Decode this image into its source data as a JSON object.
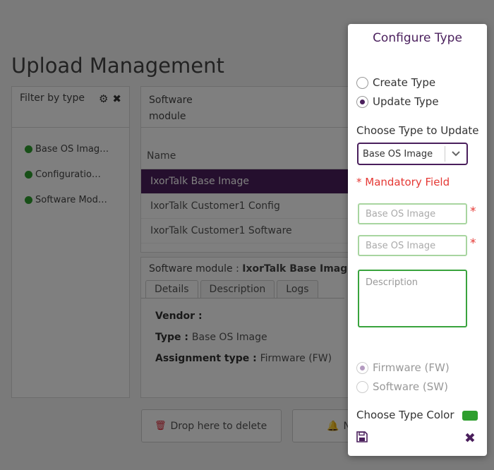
{
  "page": {
    "title": "Upload Management"
  },
  "filter": {
    "title": "Filter by type",
    "items": [
      {
        "label": "Base OS Imag…"
      },
      {
        "label": "Configuratio…"
      },
      {
        "label": "Software Mod…"
      }
    ]
  },
  "software_module": {
    "title_line1": "Software",
    "title_line2": "module",
    "column_name": "Name",
    "rows": [
      {
        "label": "IxorTalk Base Image"
      },
      {
        "label": "IxorTalk Customer1 Config"
      },
      {
        "label": "IxorTalk Customer1 Software"
      }
    ]
  },
  "details": {
    "title_prefix": "Software module : ",
    "title_value": "IxorTalk Base Image",
    "tabs": [
      {
        "label": "Details"
      },
      {
        "label": "Description"
      },
      {
        "label": "Logs"
      }
    ],
    "vendor_label": "Vendor :",
    "type_label": "Type : ",
    "type_value": "Base OS Image",
    "assignment_label": "Assignment type : ",
    "assignment_value": "Firmware (FW)"
  },
  "actions": {
    "delete_label": "Drop here to delete",
    "notify_label": "N"
  },
  "modal": {
    "title": "Configure Type",
    "create_type_label": "Create Type",
    "update_type_label": "Update Type",
    "choose_type_label": "Choose Type to Update",
    "selected_type": "Base OS Image",
    "mandatory_label": "* Mandatory Field",
    "name_placeholder": "Base OS Image",
    "key_placeholder": "Base OS Image",
    "required_marker": "*",
    "description_placeholder": "Description",
    "firmware_label": "Firmware (FW)",
    "software_label": "Software (SW)",
    "color_label": "Choose Type Color",
    "color_value": "#2e9e2e"
  }
}
